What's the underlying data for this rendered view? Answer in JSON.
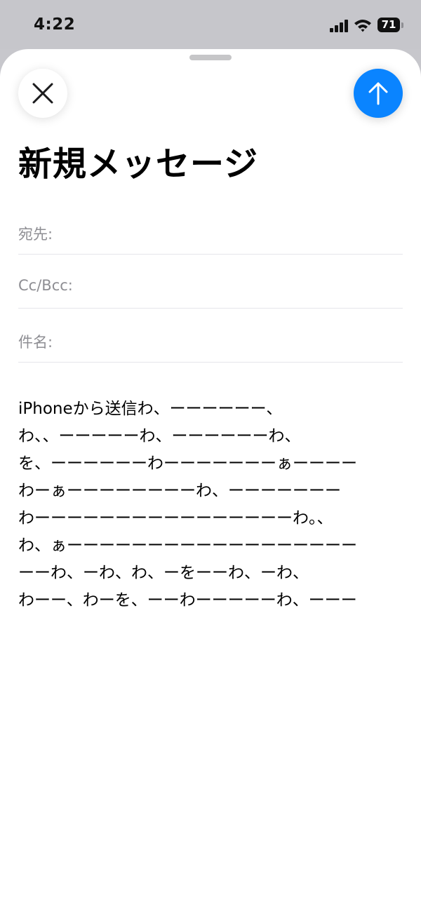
{
  "status_bar": {
    "time": "4:22",
    "battery_level": "71",
    "icons": [
      "signal-icon",
      "wifi-icon",
      "battery-icon"
    ]
  },
  "toolbar": {
    "close_icon": "close-icon",
    "send_icon": "arrow-up-icon",
    "send_color": "#0a84ff"
  },
  "compose": {
    "title": "新規メッセージ",
    "to_label": "宛先:",
    "to_value": "",
    "cc_label": "Cc/Bcc:",
    "cc_value": "",
    "subject_label": "件名:",
    "subject_value": "",
    "body": "iPhoneから送信わ、ーーーーーー、\nわ、、ーーーーーわ、ーーーーーーわ、\nを、ーーーーーーわーーーーーーーぁーーーー\nわーぁーーーーーーーーわ、ーーーーーーー\nわーーーーーーーーーーーーーーーーわ。、\nわ、ぁーーーーーーーーーーーーーーーーーー\nーーわ、ーわ、わ、ーをーーわ、ーわ、\nわーー、わーを、ーーわーーーーーわ、ーーー"
  }
}
